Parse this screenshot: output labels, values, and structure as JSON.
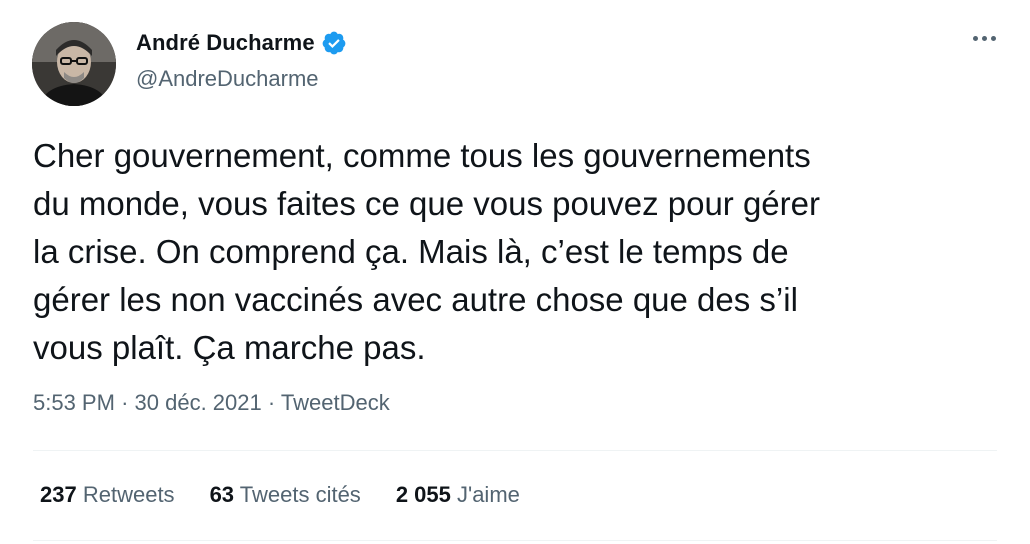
{
  "author": {
    "name": "André Ducharme",
    "handle": "@AndreDucharme",
    "verified": true
  },
  "tweet": {
    "text": "Cher gouvernement, comme tous les gouvernements\ndu monde, vous faites ce que vous pouvez pour gérer\nla crise. On comprend ça. Mais là, c’est le temps de\ngérer les non vaccinés avec autre chose que des s’il\nvous plaît. Ça marche pas.",
    "time": "5:53 PM",
    "separator": "·",
    "date": "30 déc. 2021",
    "source": "TweetDeck"
  },
  "stats": [
    {
      "count": "237",
      "label": "Retweets"
    },
    {
      "count": "63",
      "label": "Tweets cités"
    },
    {
      "count": "2 055",
      "label": "J'aime"
    }
  ],
  "colors": {
    "text": "#0f1419",
    "secondary": "#536471",
    "verified": "#1d9bf0",
    "divider": "#eff3f4"
  },
  "icons": {
    "verified": "verified-badge-icon",
    "more": "more-horizontal-icon"
  }
}
